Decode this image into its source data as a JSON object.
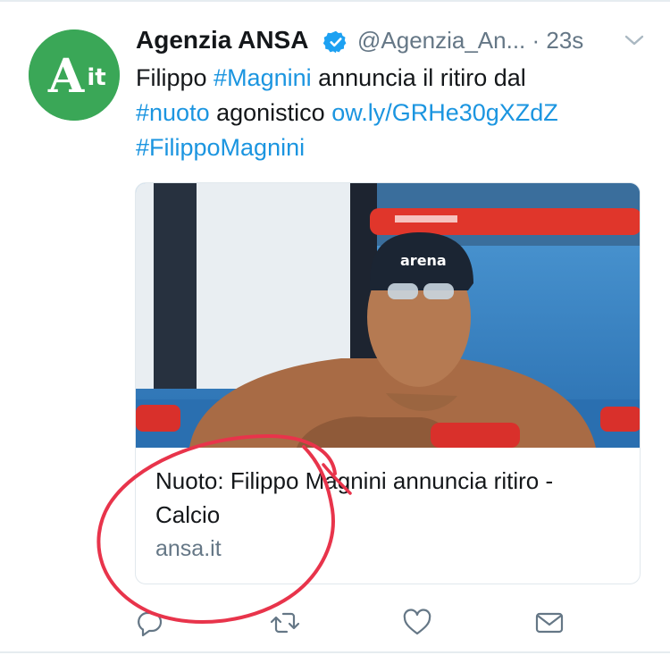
{
  "tweet": {
    "author_name": "Agenzia ANSA",
    "handle_time": "@Agenzia_An... · 23s",
    "avatar_text": "Ait",
    "text_parts": [
      "Filippo ",
      "#Magnini",
      " annuncia il ritiro dal ",
      "#nuoto",
      " agonistico ",
      "ow.ly/GRHe30gXZdZ",
      "#FilippoMagnini"
    ]
  },
  "card": {
    "title": "Nuoto: Filippo Magnini annuncia ritiro - Calcio",
    "domain": "ansa.it",
    "image_desc": "swimmer in pool"
  },
  "actions": [
    {
      "name": "reply",
      "icon": "reply-icon"
    },
    {
      "name": "retweet",
      "icon": "retweet-icon"
    },
    {
      "name": "like",
      "icon": "heart-icon"
    },
    {
      "name": "message",
      "icon": "envelope-icon"
    }
  ],
  "colors": {
    "link": "#1b95e0",
    "secondary_text": "#657786",
    "verified": "#1da1f2",
    "annotation": "#e8344b",
    "avatar_bg": "#3aa757"
  }
}
